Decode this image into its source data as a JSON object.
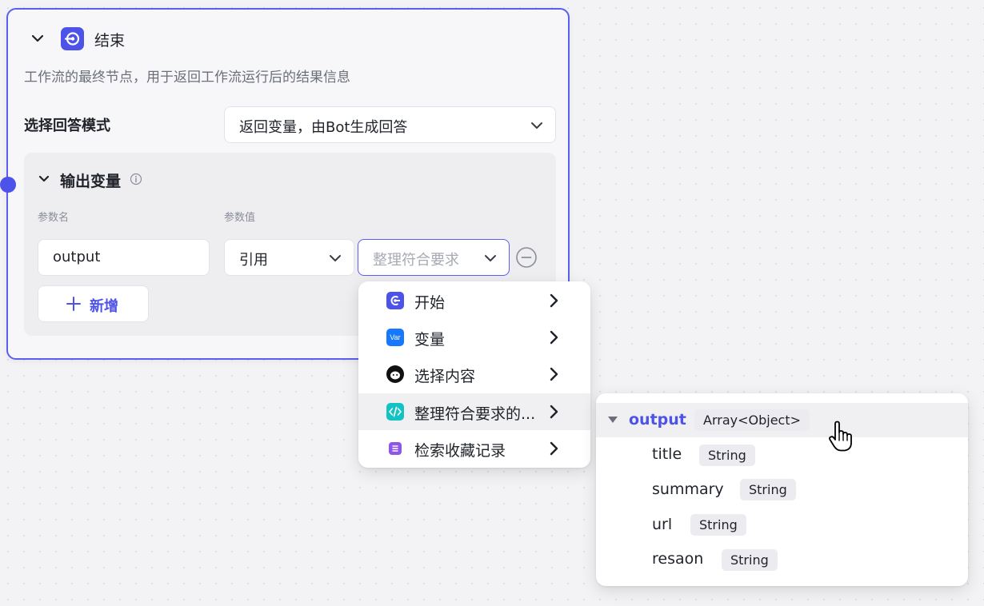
{
  "node": {
    "title": "结束",
    "description": "工作流的最终节点，用于返回工作流运行后的结果信息",
    "icon": "end-node-icon",
    "accent_color": "#4d53e8",
    "mode_label": "选择回答模式",
    "mode_value": "返回变量，由Bot生成回答",
    "output_section": {
      "title": "输出变量",
      "col_name": "参数名",
      "col_value": "参数值",
      "param_name": "output",
      "ref_type": "引用",
      "ref_placeholder": "整理符合要求",
      "add_label": "新增"
    }
  },
  "menu": {
    "items": [
      {
        "label": "开始",
        "icon": "start-icon",
        "color": "#4d53e8"
      },
      {
        "label": "变量",
        "icon": "var-icon",
        "icon_text": "Var",
        "color": "#1677ff"
      },
      {
        "label": "选择内容",
        "icon": "avatar-face-icon",
        "color": "#111111"
      },
      {
        "label": "整理符合要求的...",
        "icon": "code-icon",
        "color": "#13c2c2"
      },
      {
        "label": "检索收藏记录",
        "icon": "list-icon",
        "color": "#8e55ea"
      }
    ],
    "active_index": 3
  },
  "submenu": {
    "root": {
      "name": "output",
      "type": "Array<Object>"
    },
    "fields": [
      {
        "name": "title",
        "type": "String"
      },
      {
        "name": "summary",
        "type": "String"
      },
      {
        "name": "url",
        "type": "String"
      },
      {
        "name": "resaon",
        "type": "String"
      }
    ]
  }
}
